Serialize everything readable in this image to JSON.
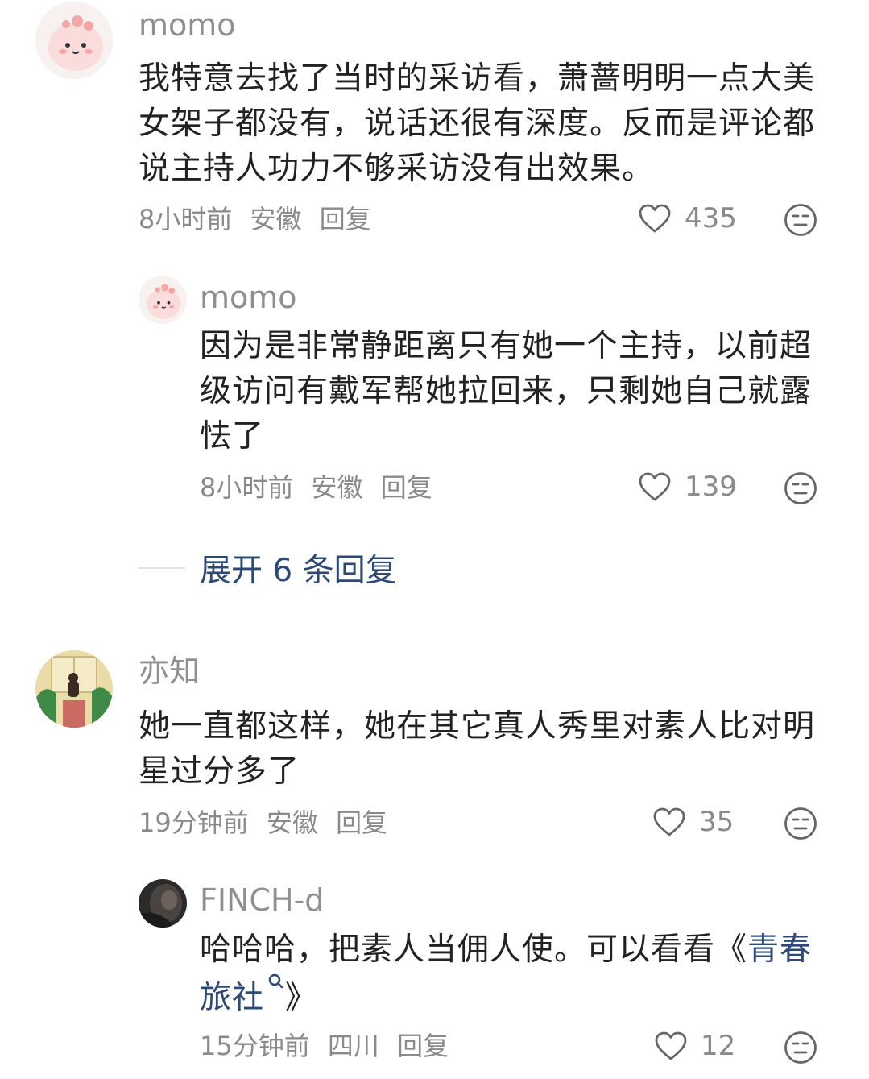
{
  "comments": [
    {
      "username": "momo",
      "text": "我特意去找了当时的采访看，萧蔷明明一点大美女架子都没有，说话还很有深度。反而是评论都说主持人功力不够采访没有出效果。",
      "time": "8小时前",
      "location": "安徽",
      "reply_label": "回复",
      "likes": "435",
      "replies": [
        {
          "username": "momo",
          "text": "因为是非常静距离只有她一个主持，以前超级访问有戴军帮她拉回来，只剩她自己就露怯了",
          "time": "8小时前",
          "location": "安徽",
          "reply_label": "回复",
          "likes": "139"
        }
      ],
      "expand_label": "展开 6 条回复"
    },
    {
      "username": "亦知",
      "text": "她一直都这样，她在其它真人秀里对素人比对明星过分多了",
      "time": "19分钟前",
      "location": "安徽",
      "reply_label": "回复",
      "likes": "35",
      "replies": [
        {
          "username": "FINCH-d",
          "text_before": "哈哈哈，把素人当佣人使。可以看看《",
          "text_link": "青春旅社",
          "text_after": "》",
          "time": "15分钟前",
          "location": "四川",
          "reply_label": "回复",
          "likes": "12"
        }
      ]
    }
  ],
  "colors": {
    "link": "#2c4a75",
    "meta": "#8a8a8a",
    "username": "#8f8f8f",
    "text": "#222222"
  },
  "icons": [
    "heart-icon",
    "dislike-face-icon",
    "search-icon"
  ]
}
